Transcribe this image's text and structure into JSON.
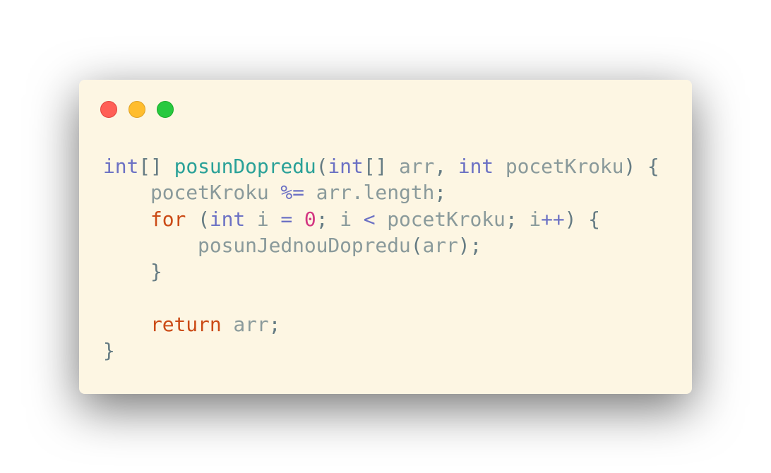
{
  "window_controls": {
    "close_color": "#ff5f56",
    "minimize_color": "#ffbd2e",
    "maximize_color": "#27c93f"
  },
  "code": {
    "lines": [
      [
        {
          "t": "int",
          "c": "kw"
        },
        {
          "t": "[] ",
          "c": "pun"
        },
        {
          "t": "posunDopredu",
          "c": "fn"
        },
        {
          "t": "(",
          "c": "pun"
        },
        {
          "t": "int",
          "c": "kw"
        },
        {
          "t": "[] ",
          "c": "pun"
        },
        {
          "t": "arr",
          "c": "id"
        },
        {
          "t": ", ",
          "c": "pun"
        },
        {
          "t": "int",
          "c": "kw"
        },
        {
          "t": " pocetKroku",
          "c": "id"
        },
        {
          "t": ") {",
          "c": "pun"
        }
      ],
      [
        {
          "t": "    pocetKroku ",
          "c": "id"
        },
        {
          "t": "%=",
          "c": "op"
        },
        {
          "t": " arr.length",
          "c": "id"
        },
        {
          "t": ";",
          "c": "pun"
        }
      ],
      [
        {
          "t": "    ",
          "c": "pun"
        },
        {
          "t": "for",
          "c": "ctl"
        },
        {
          "t": " (",
          "c": "pun"
        },
        {
          "t": "int",
          "c": "kw"
        },
        {
          "t": " i ",
          "c": "id"
        },
        {
          "t": "=",
          "c": "op"
        },
        {
          "t": " ",
          "c": "pun"
        },
        {
          "t": "0",
          "c": "num"
        },
        {
          "t": "; ",
          "c": "pun"
        },
        {
          "t": "i ",
          "c": "id"
        },
        {
          "t": "<",
          "c": "op"
        },
        {
          "t": " pocetKroku",
          "c": "id"
        },
        {
          "t": "; ",
          "c": "pun"
        },
        {
          "t": "i",
          "c": "id"
        },
        {
          "t": "++",
          "c": "op"
        },
        {
          "t": ") {",
          "c": "pun"
        }
      ],
      [
        {
          "t": "        posunJednouDopredu",
          "c": "id"
        },
        {
          "t": "(",
          "c": "pun"
        },
        {
          "t": "arr",
          "c": "id"
        },
        {
          "t": ");",
          "c": "pun"
        }
      ],
      [
        {
          "t": "    }",
          "c": "pun"
        }
      ],
      [],
      [
        {
          "t": "    ",
          "c": "pun"
        },
        {
          "t": "return",
          "c": "ctl"
        },
        {
          "t": " arr",
          "c": "id"
        },
        {
          "t": ";",
          "c": "pun"
        }
      ],
      [
        {
          "t": "}",
          "c": "pun"
        }
      ]
    ]
  }
}
